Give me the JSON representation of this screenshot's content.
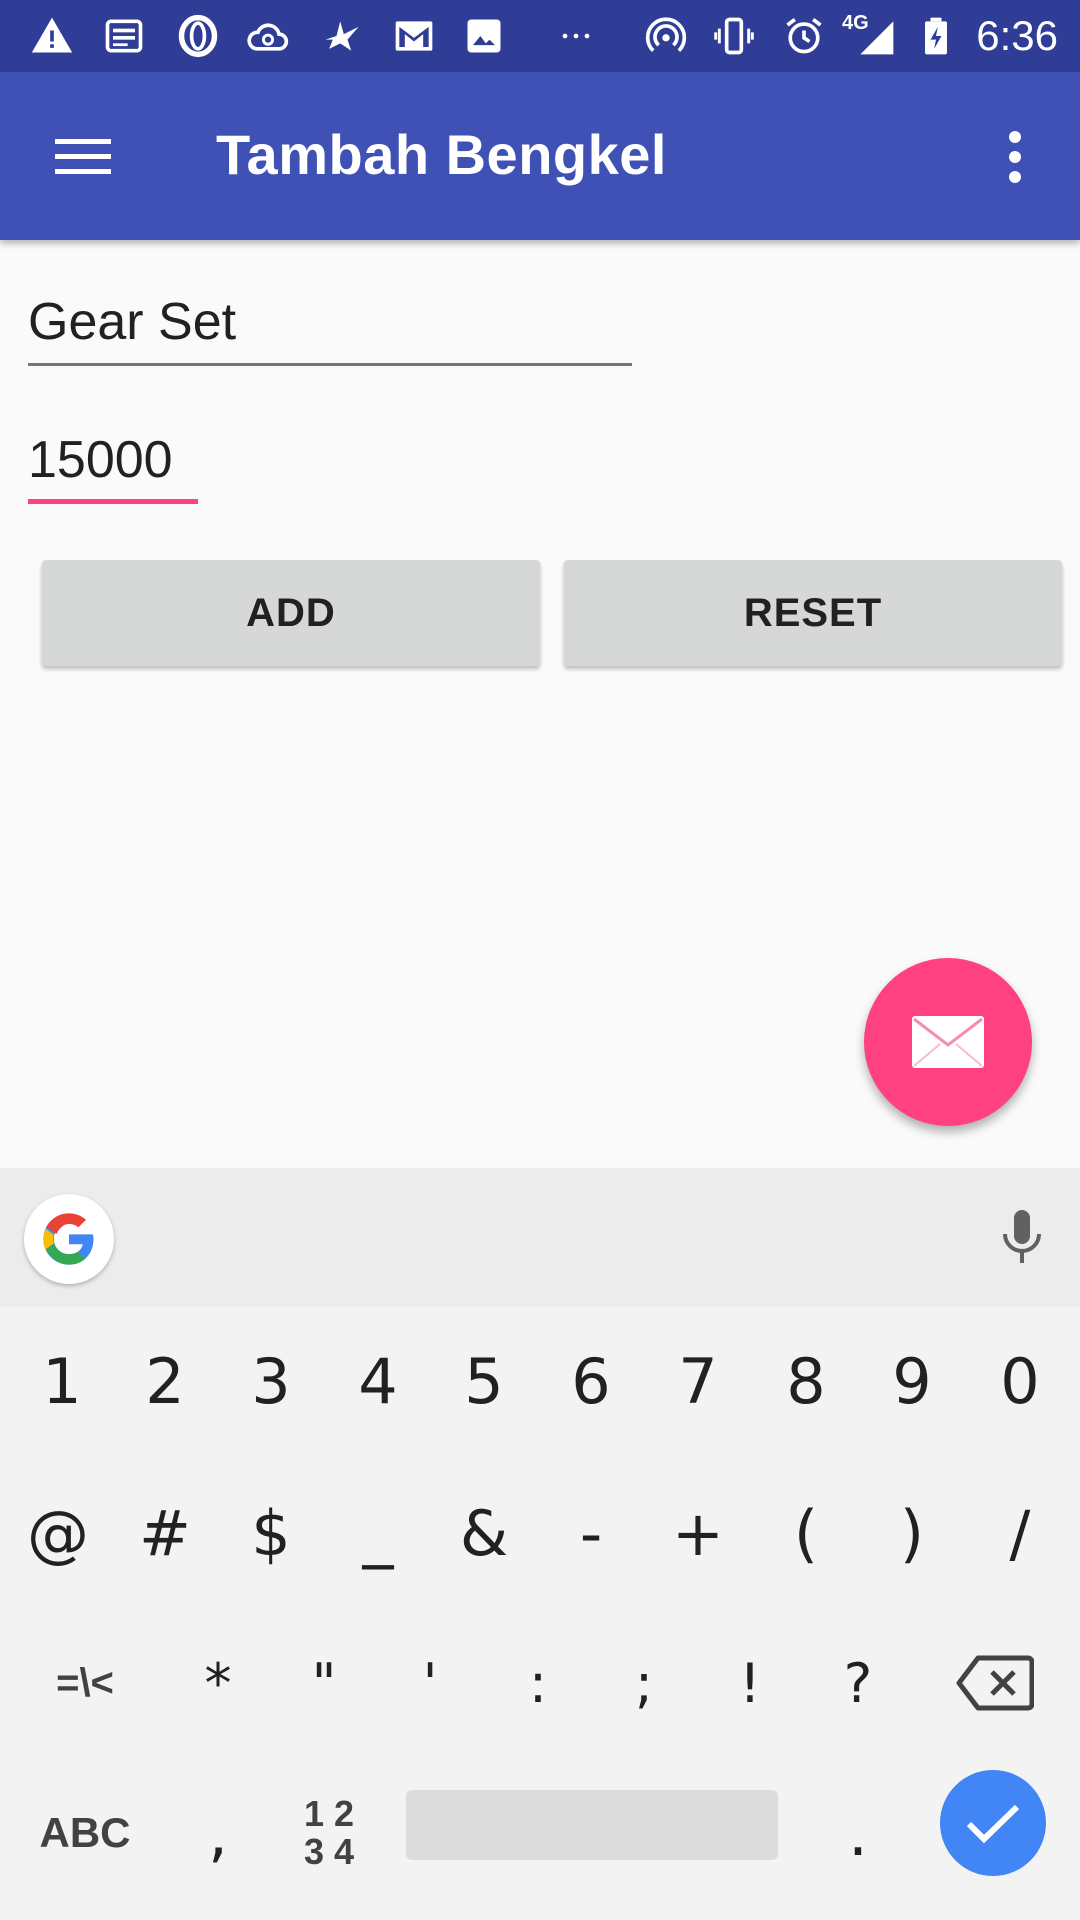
{
  "status_bar": {
    "time": "6:36",
    "network": "4G",
    "icons": [
      "warning-icon",
      "news-icon",
      "opera-icon",
      "cloud-icon",
      "bird-icon",
      "gmail-icon",
      "image-icon",
      "more-notifications-icon",
      "hotspot-icon",
      "vibrate-icon",
      "alarm-icon",
      "signal-icon",
      "battery-charging-icon"
    ]
  },
  "app_bar": {
    "title": "Tambah Bengkel",
    "menu_icon": "hamburger-menu-icon",
    "overflow_icon": "more-vert-icon",
    "color": "#3f51b5",
    "status_color": "#2f3d97"
  },
  "form": {
    "name_value": "Gear Set",
    "price_value": "15000",
    "accent_color": "#ff4081"
  },
  "buttons": {
    "add_label": "ADD",
    "reset_label": "RESET"
  },
  "fab": {
    "icon": "mail-icon",
    "color": "#ff4081"
  },
  "keyboard": {
    "row1": [
      "1",
      "2",
      "3",
      "4",
      "5",
      "6",
      "7",
      "8",
      "9",
      "0"
    ],
    "row2": [
      "@",
      "#",
      "$",
      "_",
      "&",
      "-",
      "+",
      "(",
      ")",
      "/"
    ],
    "row3": [
      "=\\<",
      "*",
      "\"",
      "'",
      ":",
      ";",
      "!",
      "?"
    ],
    "abc_label": "ABC",
    "comma": ",",
    "num_label": "1 2\n3 4",
    "period": ".",
    "enter_color": "#4285f4"
  }
}
